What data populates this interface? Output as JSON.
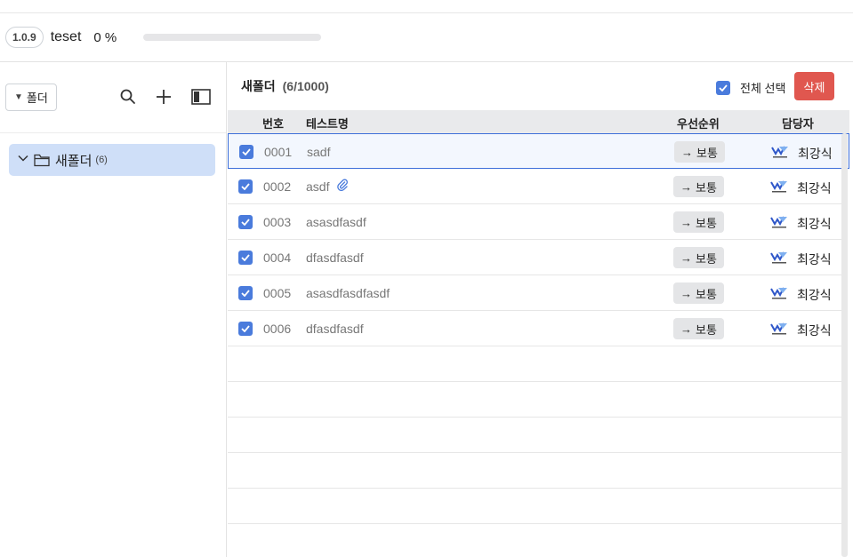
{
  "project": {
    "version": "1.0.9",
    "name": "teset",
    "progress_text": "0 %",
    "progress_value": 0
  },
  "sidebar": {
    "folder_filter_label": "폴더",
    "tree": [
      {
        "label": "새폴더",
        "count": "(6)",
        "expanded": true,
        "selected": true
      }
    ]
  },
  "main": {
    "folder_title": "새폴더",
    "folder_count": "(6/1000)",
    "select_all_label": "전체 선택",
    "delete_label": "삭제",
    "columns": {
      "number": "번호",
      "test_name": "테스트명",
      "priority": "우선순위",
      "assignee": "담당자"
    },
    "rows": [
      {
        "number": "0001",
        "name": "sadf",
        "priority": "보통",
        "assignee": "최강식",
        "checked": true,
        "attachment": false
      },
      {
        "number": "0002",
        "name": "asdf",
        "priority": "보통",
        "assignee": "최강식",
        "checked": true,
        "attachment": true
      },
      {
        "number": "0003",
        "name": "asasdfasdf",
        "priority": "보통",
        "assignee": "최강식",
        "checked": true,
        "attachment": false
      },
      {
        "number": "0004",
        "name": "dfasdfasdf",
        "priority": "보통",
        "assignee": "최강식",
        "checked": true,
        "attachment": false
      },
      {
        "number": "0005",
        "name": "asasdfasdfasdf",
        "priority": "보통",
        "assignee": "최강식",
        "checked": true,
        "attachment": false
      },
      {
        "number": "0006",
        "name": "dfasdfasdf",
        "priority": "보통",
        "assignee": "최강식",
        "checked": true,
        "attachment": false
      }
    ]
  },
  "colors": {
    "accent": "#4a7bdc",
    "danger": "#e0574f",
    "selected_folder": "#cfdff8"
  },
  "icons": [
    "search-icon",
    "plus-icon",
    "panel-toggle-icon",
    "chevron-down-icon",
    "folder-icon",
    "check-icon",
    "paperclip-icon",
    "arrow-right-icon",
    "assignee-logo"
  ]
}
